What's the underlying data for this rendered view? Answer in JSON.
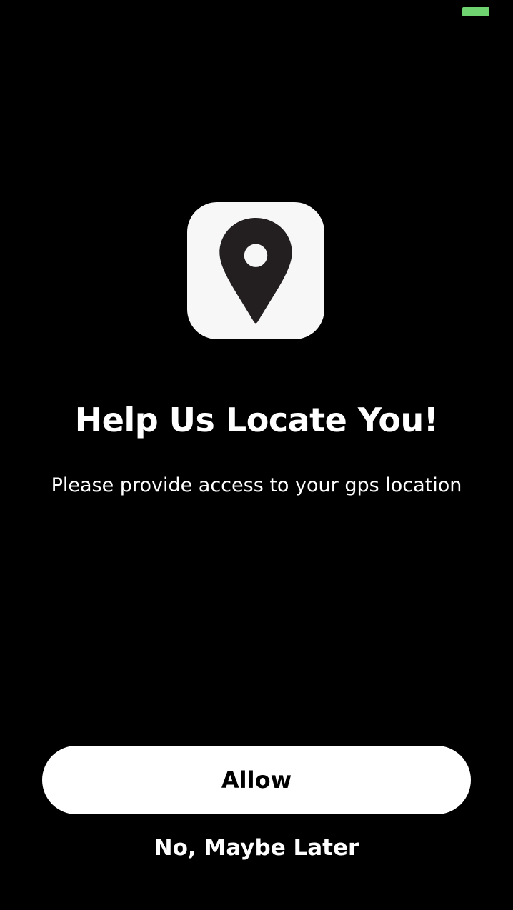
{
  "status_bar": {
    "battery_color": "#6fd36f"
  },
  "icon": {
    "name": "location-pin-icon",
    "background": "#f7f7f7",
    "pin_color": "#231f20"
  },
  "content": {
    "title": "Help Us Locate You!",
    "subtitle": "Please provide access to your gps location"
  },
  "actions": {
    "allow_label": "Allow",
    "later_label": "No, Maybe Later"
  }
}
